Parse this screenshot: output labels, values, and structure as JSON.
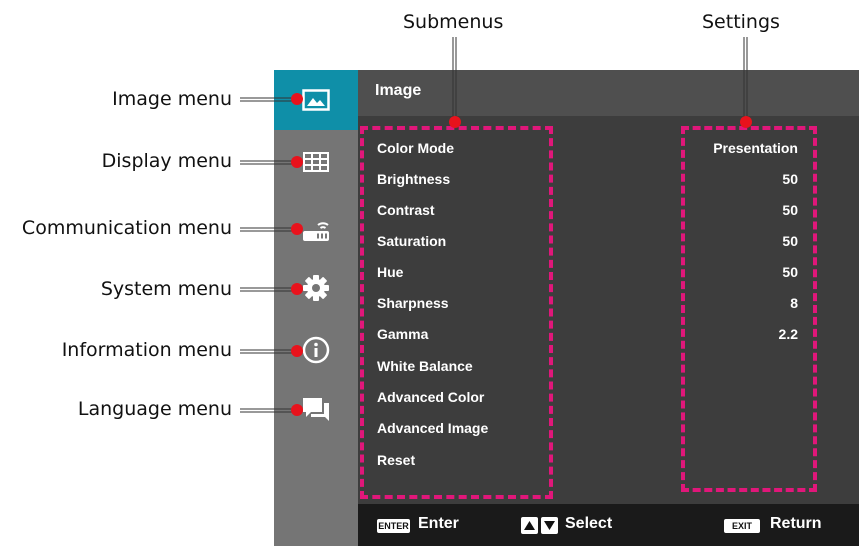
{
  "annotations": {
    "submenus": "Submenus",
    "settings": "Settings",
    "image_menu": "Image menu",
    "display_menu": "Display menu",
    "communication_menu": "Communication menu",
    "system_menu": "System menu",
    "information_menu": "Information menu",
    "language_menu": "Language menu"
  },
  "panel": {
    "title": "Image",
    "rows": [
      {
        "label": "Color Mode",
        "value": "Presentation"
      },
      {
        "label": "Brightness",
        "value": "50"
      },
      {
        "label": "Contrast",
        "value": "50"
      },
      {
        "label": "Saturation",
        "value": "50"
      },
      {
        "label": "Hue",
        "value": "50"
      },
      {
        "label": "Sharpness",
        "value": "8"
      },
      {
        "label": "Gamma",
        "value": "2.2"
      },
      {
        "label": "White Balance",
        "value": ""
      },
      {
        "label": "Advanced Color",
        "value": ""
      },
      {
        "label": "Advanced Image",
        "value": ""
      },
      {
        "label": "Reset",
        "value": ""
      }
    ]
  },
  "footer": {
    "enter_key": "ENTER",
    "enter_label": "Enter",
    "select_label": "Select",
    "exit_key": "EXIT",
    "return_label": "Return"
  },
  "sidebar_icons": [
    "image-icon",
    "display-icon",
    "communication-icon",
    "gear-icon",
    "info-icon",
    "language-icon"
  ],
  "colors": {
    "accent": "#0f8fa8",
    "sidebar": "#757575",
    "panel": "#3d3d3d",
    "header": "#4f4f4f",
    "footer": "#1a1a1a",
    "highlight": "#e0177a",
    "marker": "#e8121c"
  }
}
